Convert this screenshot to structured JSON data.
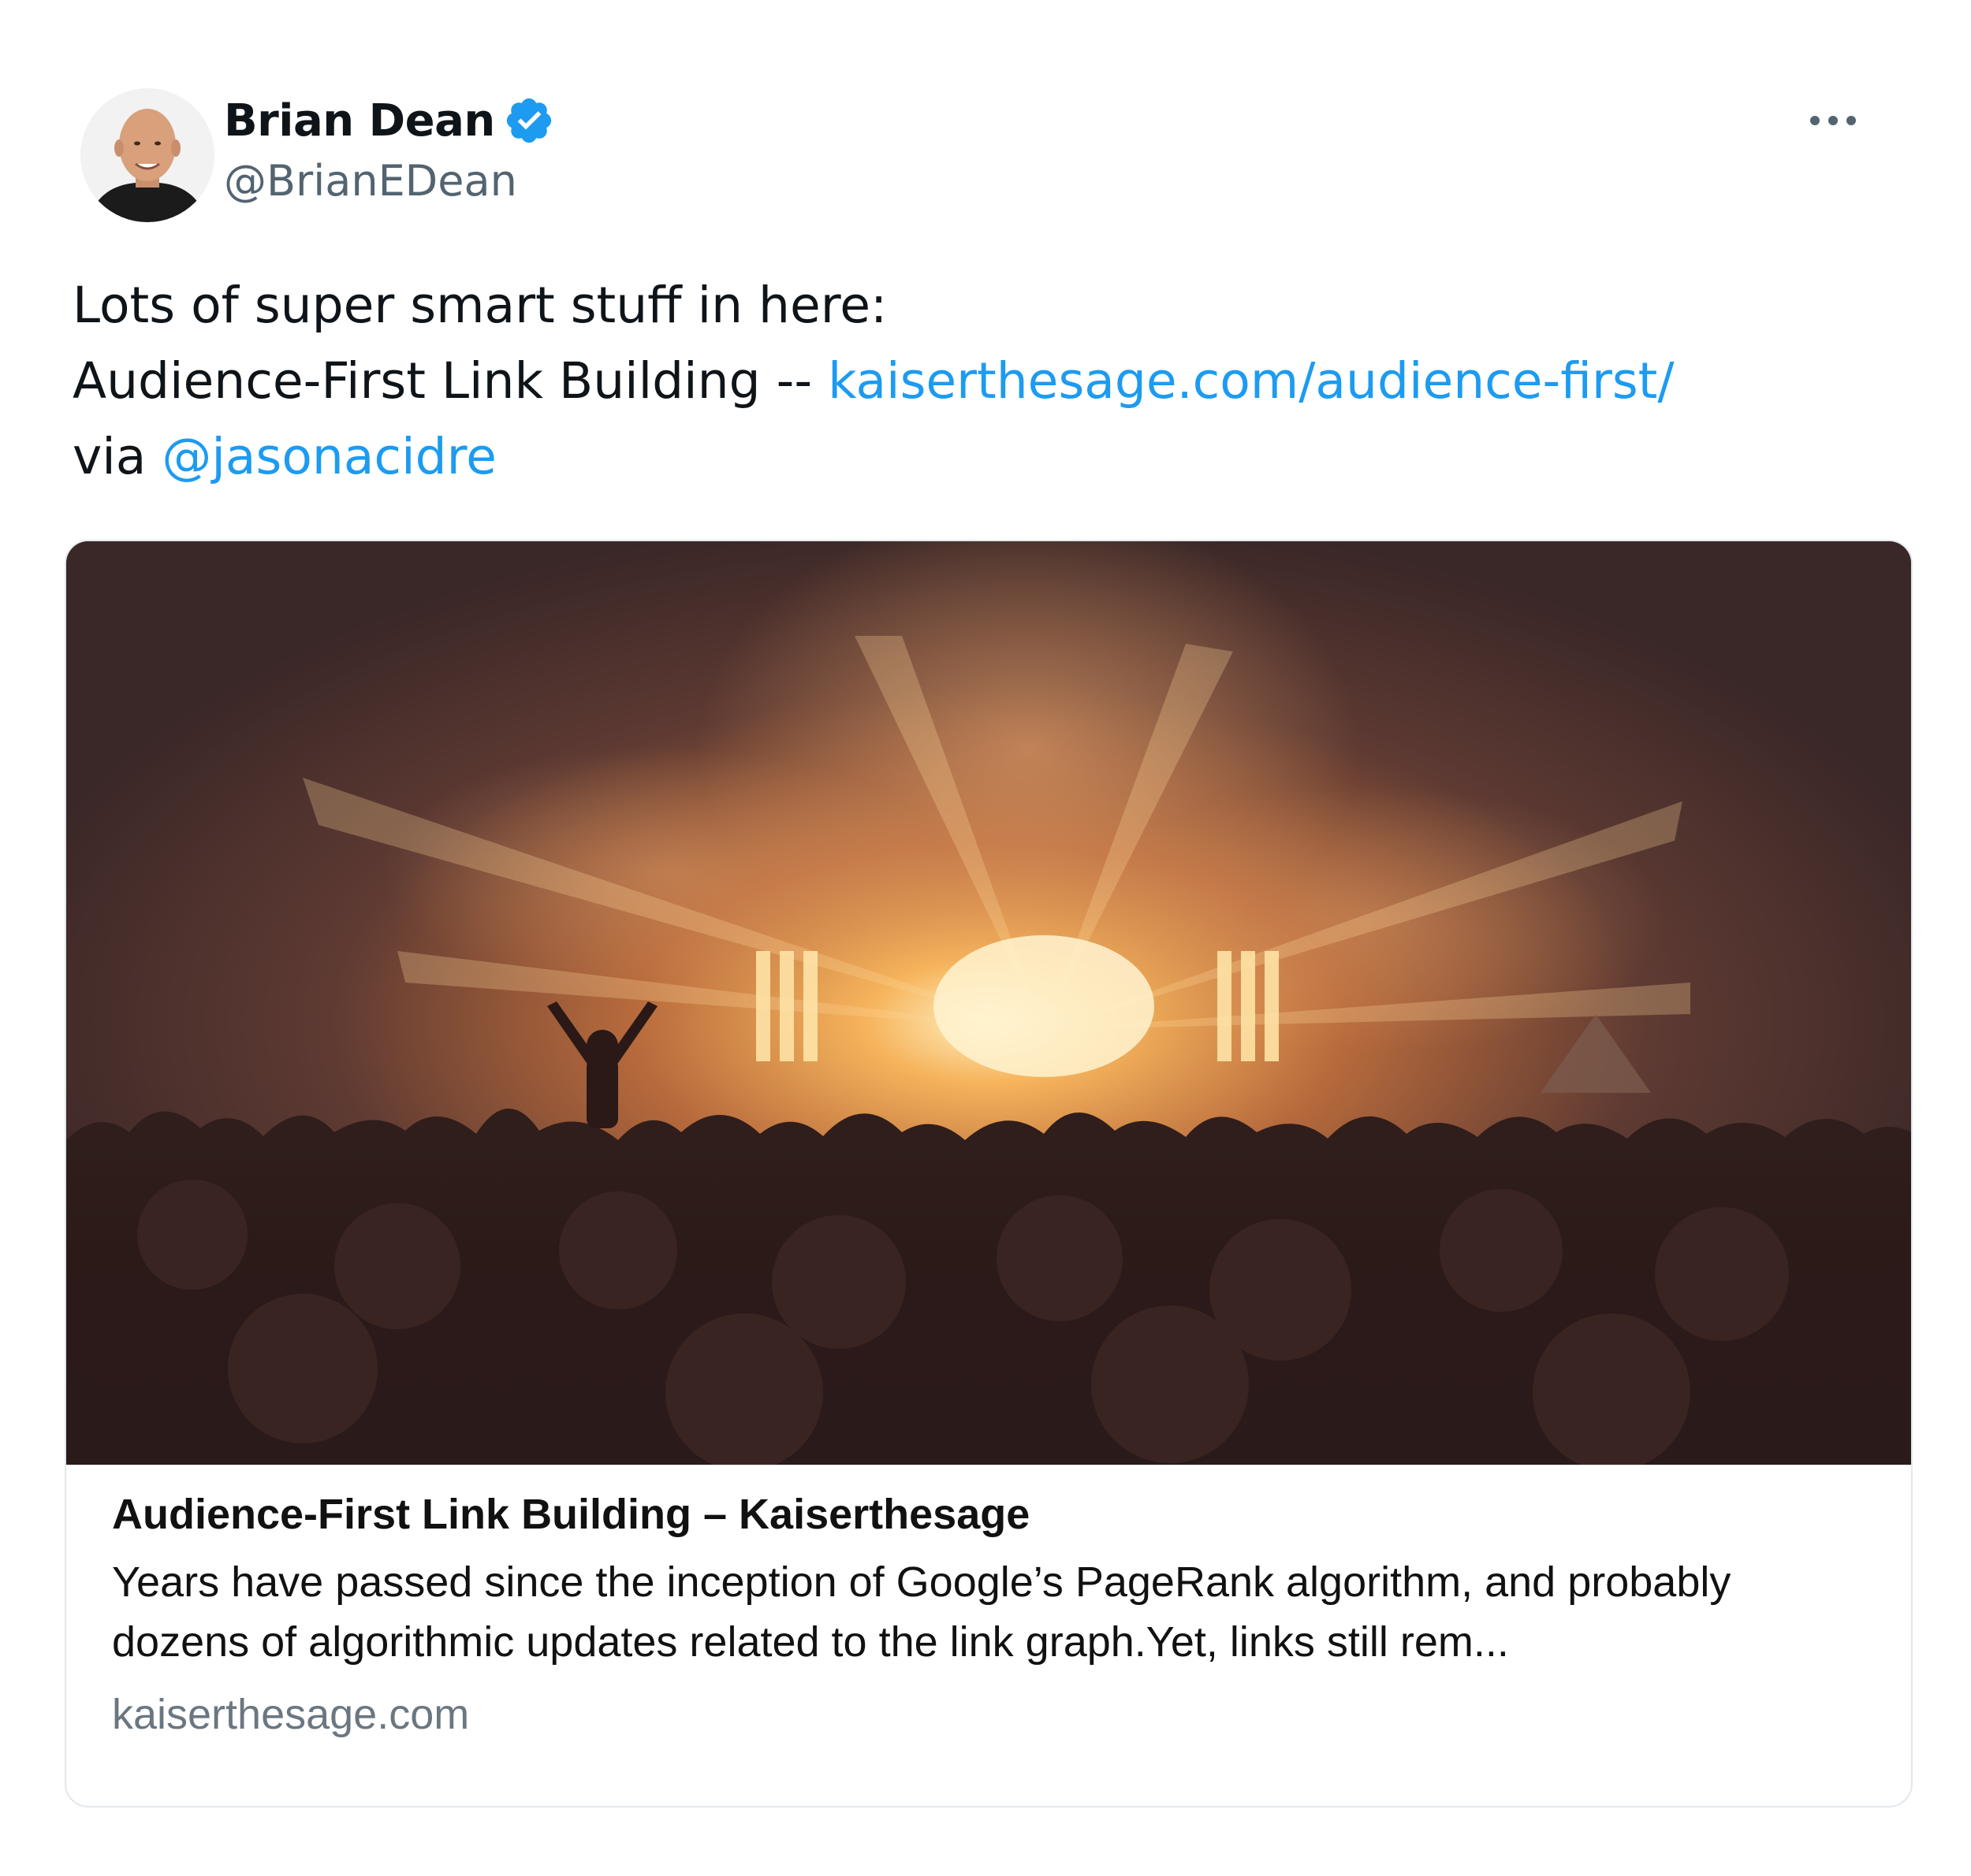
{
  "author": {
    "name": "Brian Dean",
    "handle": "@BrianEDean",
    "verified": true
  },
  "tweet": {
    "line1": "Lots of super smart stuff in here:",
    "line2_text": "Audience-First Link Building -- ",
    "line2_link": "kaiserthesage.com/audience-first/",
    "line3_text": "via ",
    "line3_mention": "@jasonacidre"
  },
  "card": {
    "title": "Audience-First Link Building – Kaiserthesage",
    "description": "Years have passed since the inception of Google’s PageRank algorithm, and probably dozens of algorithmic updates related to the link graph.Yet, links still rem...",
    "domain": "kaiserthesage.com"
  },
  "icons": {
    "avatar": "profile-photo",
    "verified": "verified-badge-icon",
    "more": "more-options-icon",
    "card_image": "concert-crowd-photo"
  },
  "colors": {
    "link": "#1d9bf0",
    "verified": "#1d9bf0",
    "secondary_text": "#536471"
  }
}
